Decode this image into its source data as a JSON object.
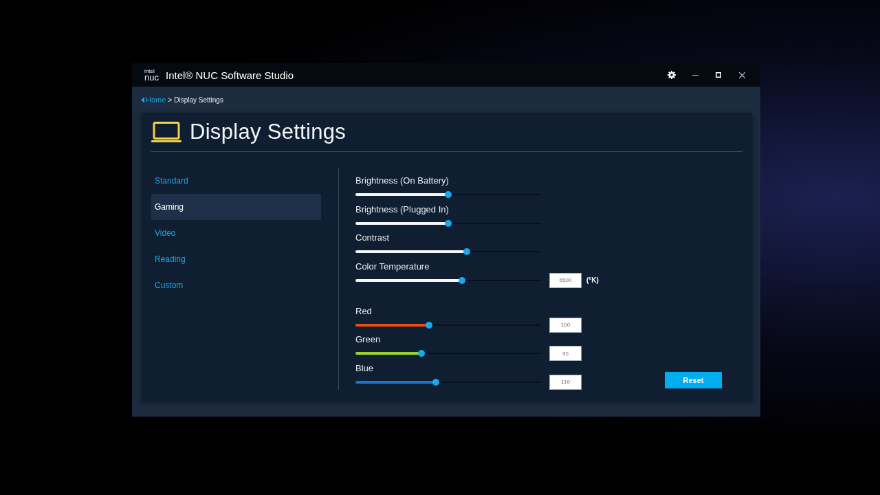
{
  "window": {
    "logo_top": "intel",
    "logo_bottom": "nuc",
    "title": "Intel® NUC Software Studio"
  },
  "breadcrumb": {
    "link": "Home",
    "separator": ">",
    "current": "Display Settings"
  },
  "page": {
    "title": "Display Settings"
  },
  "sidebar": {
    "items": [
      {
        "label": "Standard",
        "selected": false
      },
      {
        "label": "Gaming",
        "selected": true
      },
      {
        "label": "Video",
        "selected": false
      },
      {
        "label": "Reading",
        "selected": false
      },
      {
        "label": "Custom",
        "selected": false
      }
    ]
  },
  "sliders": [
    {
      "label": "Brightness (On Battery)",
      "level": 0.5
    },
    {
      "label": "Brightness (Plugged In)",
      "level": 0.5
    },
    {
      "label": "Contrast",
      "level": 0.6
    },
    {
      "label": "Color Temperature",
      "level": 0.575,
      "value": "6500",
      "unit": "(°K)"
    }
  ],
  "color_sliders": [
    {
      "label": "Red",
      "level": 0.395,
      "color": "#f04a14",
      "value": "100"
    },
    {
      "label": "Green",
      "level": 0.357,
      "color": "#9ccf2c",
      "value": "90"
    },
    {
      "label": "Blue",
      "level": 0.434,
      "color": "#1478d2",
      "value": "110"
    }
  ],
  "reset_button": "Reset"
}
